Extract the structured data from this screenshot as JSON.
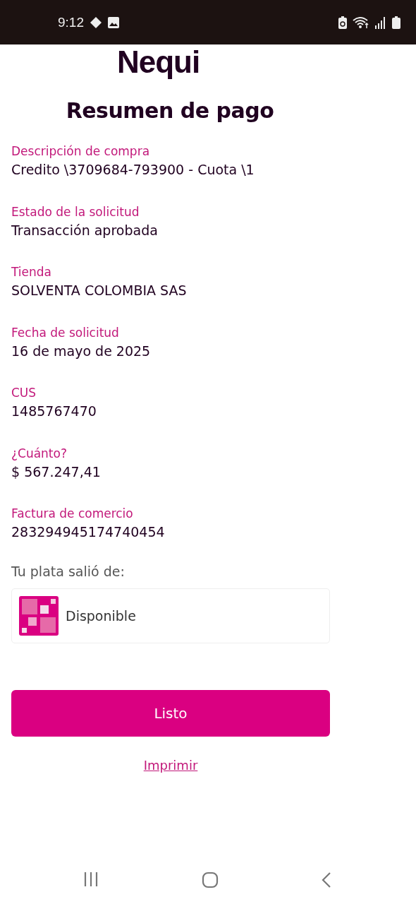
{
  "status_bar": {
    "time": "9:12"
  },
  "logo": "Nequi",
  "title": "Resumen de pago",
  "fields": [
    {
      "label": "Descripción de compra",
      "value": "Credito \\3709684-793900 - Cuota \\1"
    },
    {
      "label": "Estado de la solicitud",
      "value": "Transacción aprobada"
    },
    {
      "label": "Tienda",
      "value": "SOLVENTA COLOMBIA SAS"
    },
    {
      "label": "Fecha de solicitud",
      "value": "16 de mayo de 2025"
    },
    {
      "label": "CUS",
      "value": "1485767470"
    },
    {
      "label": "¿Cuánto?",
      "value": "$ 567.247,41"
    },
    {
      "label": "Factura de comercio",
      "value": "283294945174740454"
    }
  ],
  "source": {
    "heading": "Tu plata salió de:",
    "account": "Disponible"
  },
  "buttons": {
    "primary": "Listo",
    "link": "Imprimir"
  }
}
